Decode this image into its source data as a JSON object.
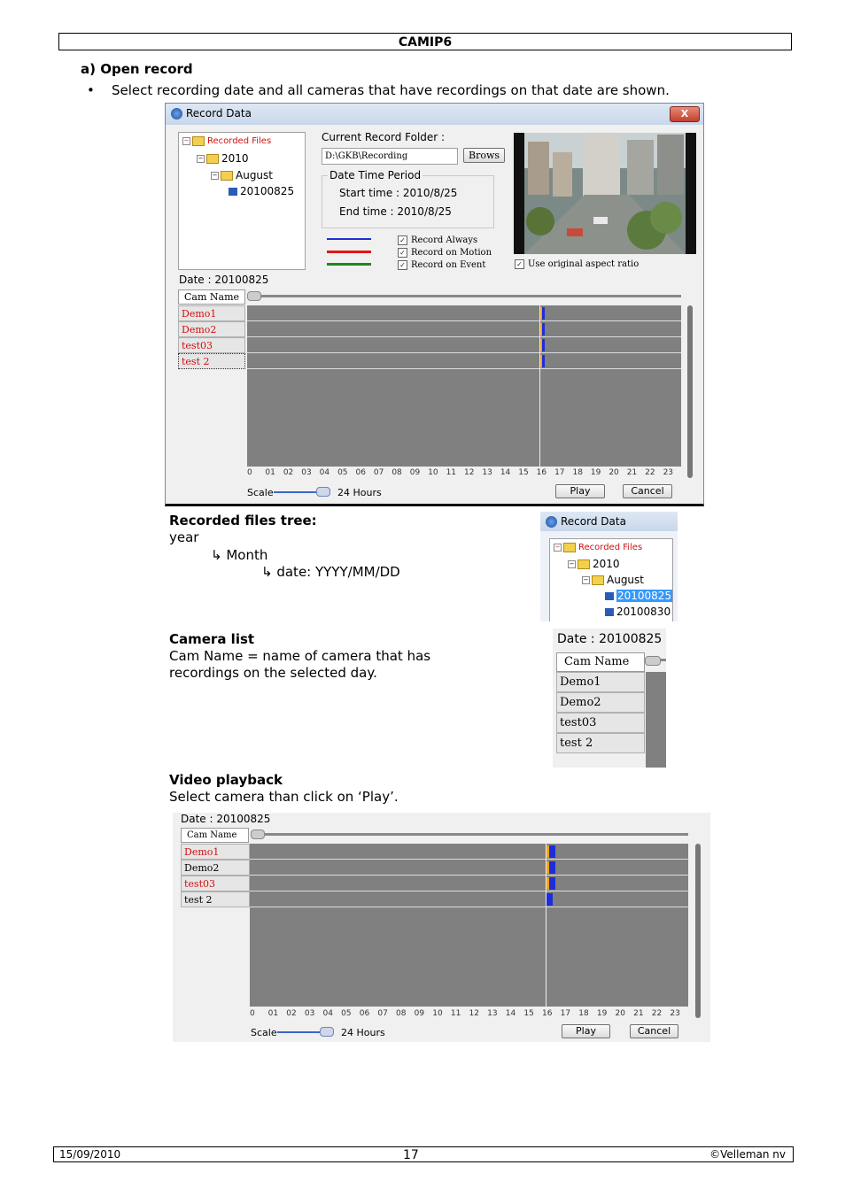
{
  "header": {
    "title": "CAMIP6"
  },
  "section_a": {
    "title": "a) Open record",
    "bullet": "Select recording date and all cameras that have recordings on that date are shown."
  },
  "record_window": {
    "title": "Record Data",
    "close_label": "X",
    "tree": {
      "root": "Recorded Files",
      "year": "2010",
      "month": "August",
      "date": "20100825"
    },
    "current_folder_label": "Current Record Folder :",
    "folder_value": "D:\\GKB\\Recording",
    "browse_label": "Brows",
    "period_title": "Date Time Period",
    "start_time": "Start time : 2010/8/25",
    "end_time": "End time : 2010/8/25",
    "legend": [
      "Record Always",
      "Record on Motion",
      "Record on Event"
    ],
    "legend_colors": [
      "#1c2fd6",
      "#e01515",
      "#1a8a1a"
    ],
    "aspect_label": "Use original aspect ratio",
    "date_label": "Date : 20100825",
    "cam_name_header": "Cam Name",
    "cameras": [
      "Demo1",
      "Demo2",
      "test03",
      "test 2"
    ],
    "hours": [
      "0",
      "01",
      "02",
      "03",
      "04",
      "05",
      "06",
      "07",
      "08",
      "09",
      "10",
      "11",
      "12",
      "13",
      "14",
      "15",
      "16",
      "17",
      "18",
      "19",
      "20",
      "21",
      "22",
      "23"
    ],
    "scale_label": "Scale",
    "scale_value": "24 Hours",
    "play_label": "Play",
    "cancel_label": "Cancel"
  },
  "recorded_files": {
    "title": "Recorded files tree:",
    "line_year": "year",
    "line_month": "Month",
    "line_date": "date: YYYY/MM/DD",
    "arrow_icon": "arrow-icon",
    "thumb": {
      "title": "Record Data",
      "root": "Recorded Files",
      "year": "2010",
      "month": "August",
      "dates": [
        "20100825",
        "20100830"
      ]
    }
  },
  "camera_list": {
    "title": "Camera list",
    "desc": "Cam Name = name of camera that has recordings on the selected day.",
    "date_label": "Date : 20100825",
    "header": "Cam Name",
    "cameras": [
      "Demo1",
      "Demo2",
      "test03",
      "test 2"
    ]
  },
  "video_playback": {
    "title": "Video playback",
    "desc": "Select camera than click on ‘Play’.",
    "date_label": "Date : 20100825",
    "header": "Cam Name",
    "cameras": [
      "Demo1",
      "Demo2",
      "test03",
      "test 2"
    ],
    "scale_label": "Scale",
    "scale_value": "24 Hours",
    "play_label": "Play",
    "cancel_label": "Cancel"
  },
  "footer": {
    "date": "15/09/2010",
    "page": "17",
    "copyright": "©Velleman nv"
  }
}
